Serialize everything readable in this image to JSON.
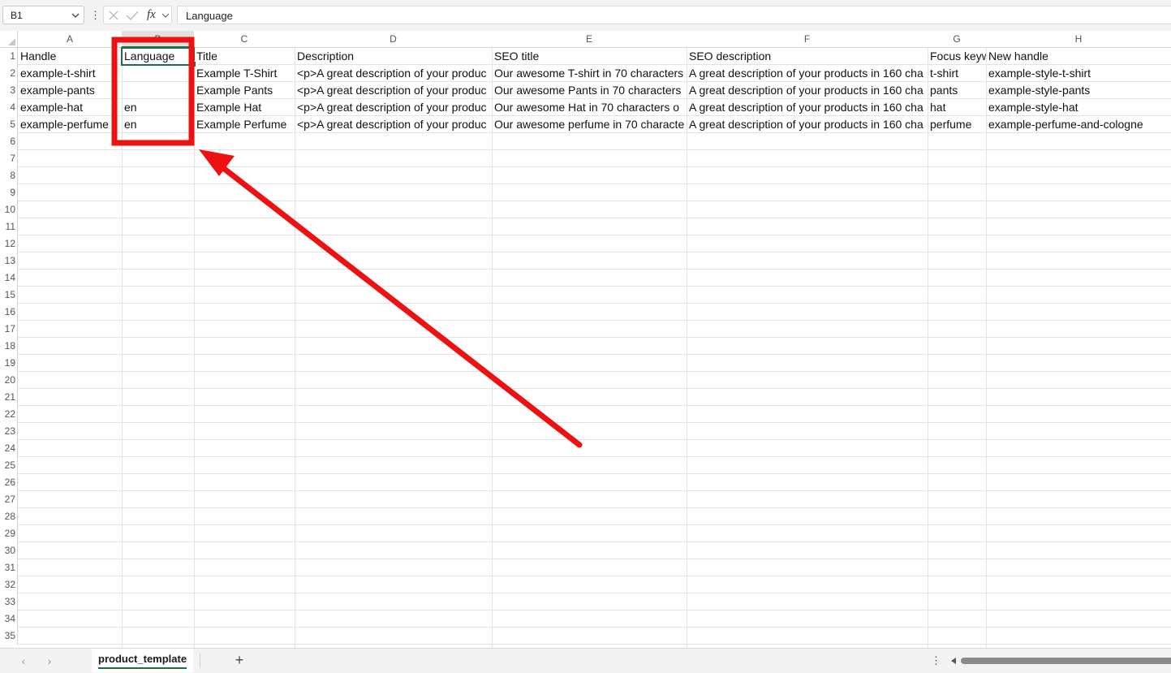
{
  "formula_bar": {
    "name_box": "B1",
    "formula": "Language"
  },
  "columns": [
    "A",
    "B",
    "C",
    "D",
    "E",
    "F",
    "G",
    "H"
  ],
  "rows": [
    "1",
    "2",
    "3",
    "4",
    "5",
    "6",
    "7",
    "8",
    "9",
    "10",
    "11",
    "12",
    "13",
    "14",
    "15",
    "16",
    "17",
    "18",
    "19",
    "20",
    "21",
    "22",
    "23",
    "24",
    "25",
    "26",
    "27",
    "28",
    "29",
    "30",
    "31",
    "32",
    "33",
    "34",
    "35"
  ],
  "cells": [
    [
      "Handle",
      "Language",
      "Title",
      "Description",
      "SEO title",
      "SEO description",
      "Focus keyw",
      "New handle"
    ],
    [
      "example-t-shirt",
      "",
      "Example T-Shirt",
      "<p>A great description of your produc",
      "Our awesome T-shirt in 70 characters",
      "A great description of your products in 160 cha",
      "t-shirt",
      "example-style-t-shirt"
    ],
    [
      "example-pants",
      "",
      "Example Pants",
      "<p>A great description of your produc",
      "Our awesome Pants in 70 characters",
      "A great description of your products in 160 cha",
      "pants",
      "example-style-pants"
    ],
    [
      "example-hat",
      "en",
      "Example Hat",
      "<p>A great description of your produc",
      "Our awesome Hat in 70 characters o",
      "A great description of your products in 160 cha",
      "hat",
      "example-style-hat"
    ],
    [
      "example-perfume",
      "en",
      "Example Perfume",
      "<p>A great description of your produc",
      "Our awesome perfume in 70 characte",
      "A great description of your products in 160 cha",
      "perfume",
      "example-perfume-and-cologne"
    ]
  ],
  "active_cell": "B1",
  "sheet_tabs": [
    {
      "label": "product_template",
      "active": true
    }
  ],
  "icons": {
    "name_box_dropdown": "chevron-down-icon",
    "more": "more-vertical-icon",
    "cancel": "close-icon",
    "confirm": "check-icon",
    "function": "fx-icon",
    "prev_sheet": "chevron-left-icon",
    "next_sheet": "chevron-right-icon",
    "add_sheet": "plus-icon"
  },
  "colors": {
    "selection": "#1d6f42",
    "annotation": "#ee1111",
    "header_bg": "#f3f3f3"
  }
}
